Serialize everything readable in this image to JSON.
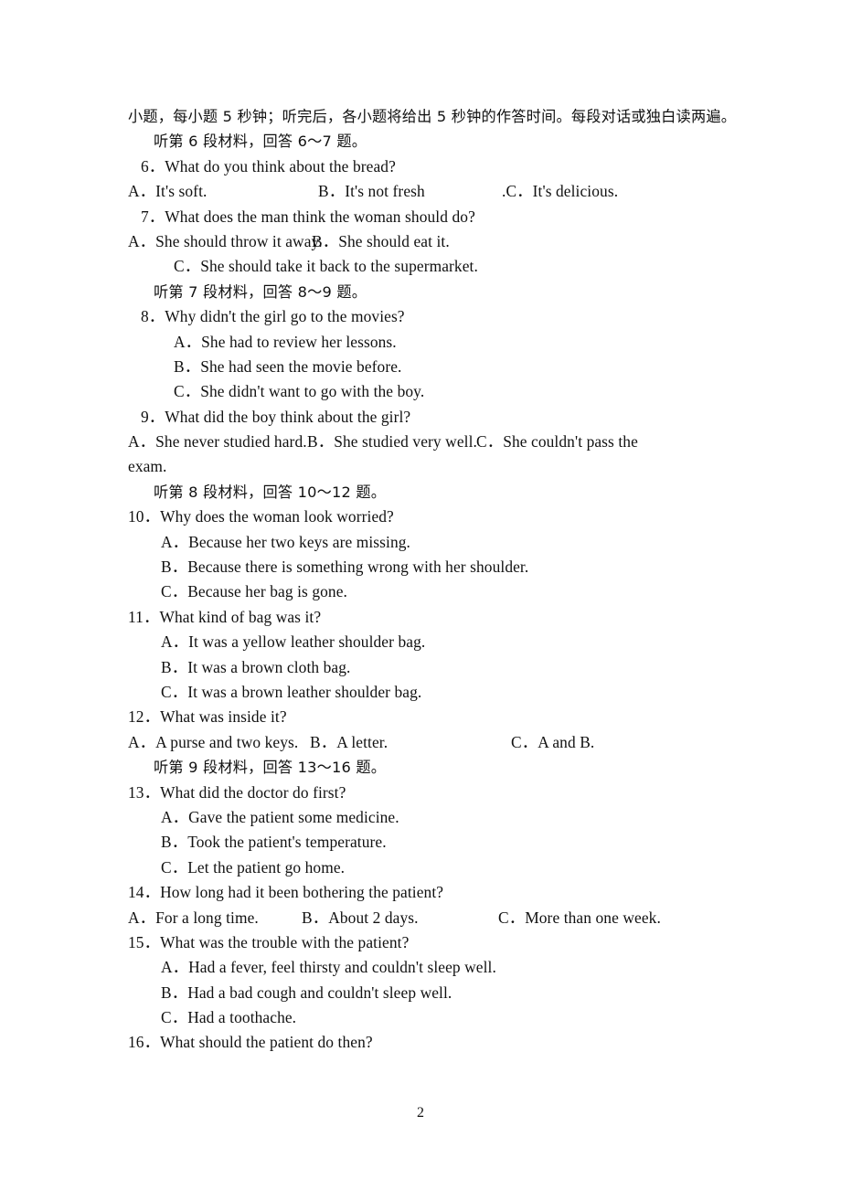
{
  "document": {
    "page_number": "2",
    "header_line": "小题，每小题 5 秒钟；听完后，各小题将给出 5 秒钟的作答时间。每段对话或独白读两遍。",
    "section_headings": {
      "m6": "听第 6 段材料，回答 6～7 题。",
      "m7": "听第 7 段材料，回答 8～9 题。",
      "m8": "听第 8 段材料，回答 10～12 题。",
      "m9": "听第 9 段材料，回答 13～16 题。"
    },
    "questions": {
      "q6": {
        "number": "6．",
        "text": "What do you think about the bread?",
        "a": "A．It's soft.",
        "b": "B．It's not fresh",
        "c": ".C．It's delicious."
      },
      "q7": {
        "number": "7．",
        "text": "What does the man think the woman should do?",
        "a": "A．She should throw it away.",
        "b": "B．She should eat it.",
        "c": "C．She should take it back to the supermarket."
      },
      "q8": {
        "number": "8．",
        "text": "Why didn't the girl go to the movies?",
        "a": "A．She had to review her lessons.",
        "b": "B．She had seen the movie before.",
        "c": "C．She didn't want to go with the boy."
      },
      "q9": {
        "number": "9．",
        "text": "What did the boy think about the girl?",
        "a": "A．She never studied hard.",
        "b": "B．She studied very well.",
        "c": "C．She couldn't pass the",
        "c_wrap": "exam."
      },
      "q10": {
        "number": "10．",
        "text": "Why does the woman look worried?",
        "a": "A．Because her two keys are missing.",
        "b": "B．Because there is something wrong with her shoulder.",
        "c": "C．Because her bag is gone."
      },
      "q11": {
        "number": "11．",
        "text": "What kind of bag was it?",
        "a": "A．It was a yellow leather shoulder bag.",
        "b": "B．It was a brown cloth bag.",
        "c": "C．It was a brown leather shoulder bag."
      },
      "q12": {
        "number": "12．",
        "text": "What was inside it?",
        "a": "A．A purse and two keys.",
        "b": "B．A letter.",
        "c": "C．A and B."
      },
      "q13": {
        "number": "13．",
        "text": "What did the doctor do first?",
        "a": "A．Gave the patient some medicine.",
        "b": "B．Took the patient's temperature.",
        "c": "C．Let the patient go home."
      },
      "q14": {
        "number": "14．",
        "text": "How long had it been bothering the patient?",
        "a": "A．For a long time.",
        "b": "B．About 2 days.",
        "c": "C．More than one week."
      },
      "q15": {
        "number": "15．",
        "text": "What was the trouble with the patient?",
        "a": "A．Had a fever, feel thirsty and couldn't sleep well.",
        "b": "B．Had a bad cough and couldn't sleep well.",
        "c": "C．Had a toothache."
      },
      "q16": {
        "number": "16．",
        "text": "What should the patient do then?"
      }
    }
  }
}
